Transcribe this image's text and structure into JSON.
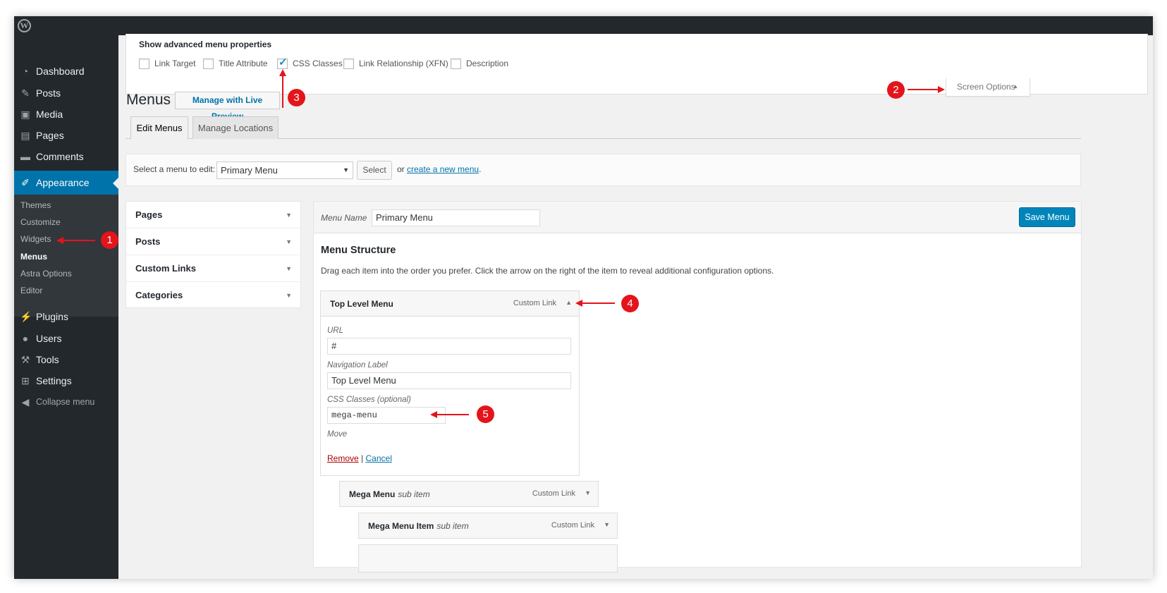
{
  "sidebar": {
    "items": [
      {
        "label": "Dashboard",
        "icon": "dashboard-icon"
      },
      {
        "label": "Posts",
        "icon": "pushpin-icon"
      },
      {
        "label": "Media",
        "icon": "media-icon"
      },
      {
        "label": "Pages",
        "icon": "pages-icon"
      },
      {
        "label": "Comments",
        "icon": "comments-icon"
      },
      {
        "label": "Appearance",
        "icon": "paintbrush-icon"
      },
      {
        "label": "Plugins",
        "icon": "plugin-icon"
      },
      {
        "label": "Users",
        "icon": "users-icon"
      },
      {
        "label": "Tools",
        "icon": "wrench-icon"
      },
      {
        "label": "Settings",
        "icon": "settings-icon"
      }
    ],
    "submenu": [
      "Themes",
      "Customize",
      "Widgets",
      "Menus",
      "Astra Options",
      "Editor"
    ],
    "collapse_label": "Collapse menu"
  },
  "screen_options": {
    "panel_title": "Show advanced menu properties",
    "options": [
      {
        "label": "Link Target",
        "checked": false
      },
      {
        "label": "Title Attribute",
        "checked": false
      },
      {
        "label": "CSS Classes",
        "checked": true
      },
      {
        "label": "Link Relationship (XFN)",
        "checked": false
      },
      {
        "label": "Description",
        "checked": false
      }
    ],
    "tab_label": "Screen Options"
  },
  "page": {
    "title": "Menus",
    "live_preview_label": "Manage with Live Preview",
    "tabs": [
      "Edit Menus",
      "Manage Locations"
    ]
  },
  "select_bar": {
    "label": "Select a menu to edit:",
    "selected": "Primary Menu",
    "button": "Select",
    "or_text": "or",
    "create_link": "create a new menu",
    "period": "."
  },
  "accordion": [
    "Pages",
    "Posts",
    "Custom Links",
    "Categories"
  ],
  "editor": {
    "menu_name_label": "Menu Name",
    "menu_name_value": "Primary Menu",
    "save_label": "Save Menu",
    "structure_title": "Menu Structure",
    "structure_desc": "Drag each item into the order you prefer. Click the arrow on the right of the item to reveal additional configuration options."
  },
  "menu_items": [
    {
      "title": "Top Level Menu",
      "sub": "",
      "type": "Custom Link"
    },
    {
      "title": "Mega Menu",
      "sub": "sub item",
      "type": "Custom Link"
    },
    {
      "title": "Mega Menu Item",
      "sub": "sub item",
      "type": "Custom Link"
    }
  ],
  "item_settings": {
    "url_label": "URL",
    "url_value": "#",
    "nav_label_label": "Navigation Label",
    "nav_label_value": "Top Level Menu",
    "css_label": "CSS Classes (optional)",
    "css_value": "mega-menu",
    "move_label": "Move",
    "remove": "Remove",
    "separator": "|",
    "cancel": "Cancel"
  },
  "annotations": [
    "1",
    "2",
    "3",
    "4",
    "5"
  ],
  "colors": {
    "accent": "#0073aa",
    "annotation": "#e4141b",
    "sidebar": "#23282d"
  }
}
